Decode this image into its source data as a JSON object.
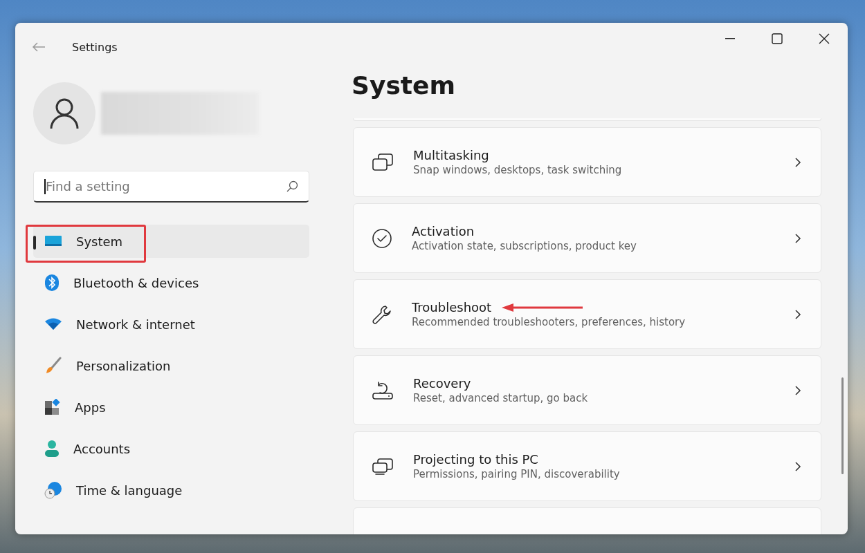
{
  "window": {
    "title": "Settings"
  },
  "search": {
    "placeholder": "Find a setting"
  },
  "nav": [
    {
      "label": "System",
      "selected": true
    },
    {
      "label": "Bluetooth & devices",
      "selected": false
    },
    {
      "label": "Network & internet",
      "selected": false
    },
    {
      "label": "Personalization",
      "selected": false
    },
    {
      "label": "Apps",
      "selected": false
    },
    {
      "label": "Accounts",
      "selected": false
    },
    {
      "label": "Time & language",
      "selected": false
    }
  ],
  "page": {
    "title": "System"
  },
  "cards": [
    {
      "title": "Multitasking",
      "subtitle": "Snap windows, desktops, task switching",
      "pointed": false
    },
    {
      "title": "Activation",
      "subtitle": "Activation state, subscriptions, product key",
      "pointed": false
    },
    {
      "title": "Troubleshoot",
      "subtitle": "Recommended troubleshooters, preferences, history",
      "pointed": true
    },
    {
      "title": "Recovery",
      "subtitle": "Reset, advanced startup, go back",
      "pointed": false
    },
    {
      "title": "Projecting to this PC",
      "subtitle": "Permissions, pairing PIN, discoverability",
      "pointed": false
    }
  ]
}
